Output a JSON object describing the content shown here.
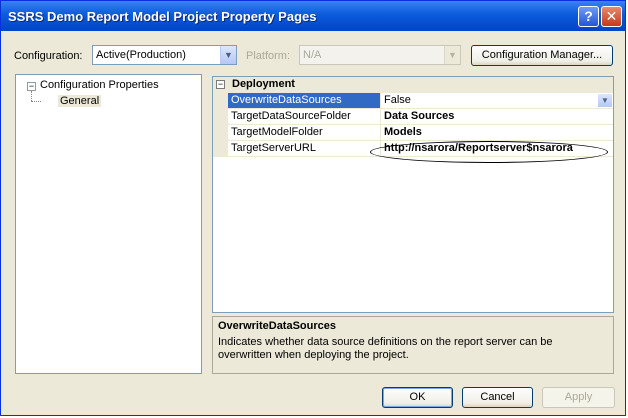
{
  "window": {
    "title": "SSRS Demo Report Model Project Property Pages",
    "help_glyph": "?",
    "close_glyph": "✕"
  },
  "toolbar": {
    "configuration_label": "Configuration:",
    "configuration_value": "Active(Production)",
    "platform_label": "Platform:",
    "platform_value": "N/A",
    "config_manager_button": "Configuration Manager..."
  },
  "tree": {
    "root_label": "Configuration Properties",
    "child_label": "General",
    "expander_glyph": "−"
  },
  "property_grid": {
    "category": "Deployment",
    "expander_glyph": "−",
    "rows": [
      {
        "name": "OverwriteDataSources",
        "value": "False"
      },
      {
        "name": "TargetDataSourceFolder",
        "value": "Data Sources"
      },
      {
        "name": "TargetModelFolder",
        "value": "Models"
      },
      {
        "name": "TargetServerURL",
        "value": "http://nsarora/Reportserver$nsarora"
      }
    ]
  },
  "description": {
    "title": "OverwriteDataSources",
    "text": "Indicates whether data source definitions on the report server can be overwritten when deploying the project."
  },
  "buttons": {
    "ok": "OK",
    "cancel": "Cancel",
    "apply": "Apply"
  },
  "icons": {
    "dropdown": "▼"
  }
}
